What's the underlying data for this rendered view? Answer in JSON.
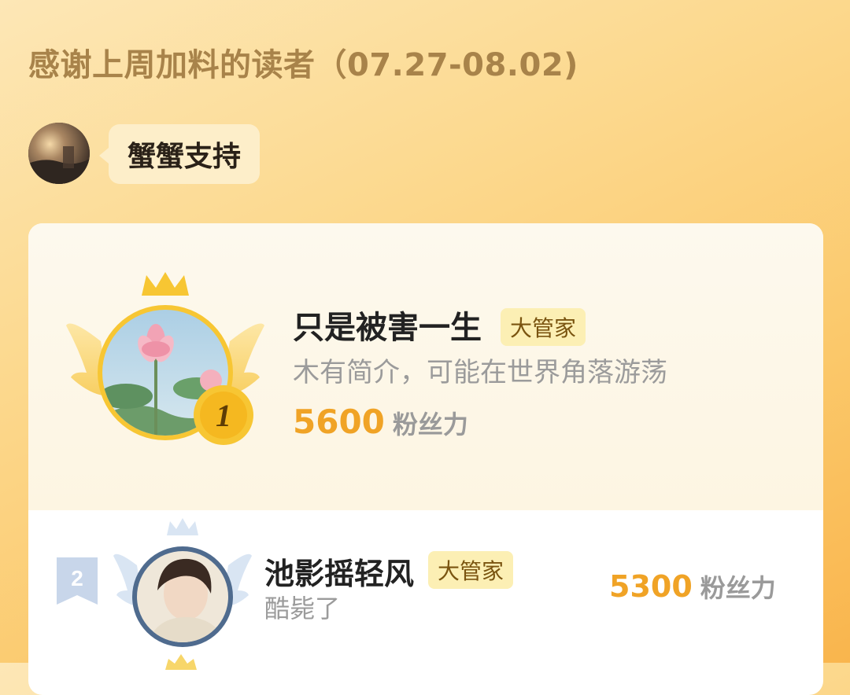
{
  "header": {
    "title": "感谢上周加料的读者（07.27-08.02)"
  },
  "support": {
    "label": "蟹蟹支持"
  },
  "leaderboard": [
    {
      "rank": "1",
      "name": "只是被害一生",
      "badge": "大管家",
      "bio": "木有简介，可能在世界角落游荡",
      "score": "5600",
      "score_unit": "粉丝力"
    },
    {
      "rank": "2",
      "name": "池影摇轻风",
      "badge": "大管家",
      "bio": "酷毙了",
      "score": "5300",
      "score_unit": "粉丝力"
    }
  ],
  "colors": {
    "accent": "#f0a326",
    "title": "#a8834a",
    "badge_bg": "#fcefb4",
    "gold": "#f7c633"
  },
  "icons": [
    "crown-icon",
    "wings-icon",
    "rank-medal-icon",
    "rank-flag-icon"
  ]
}
